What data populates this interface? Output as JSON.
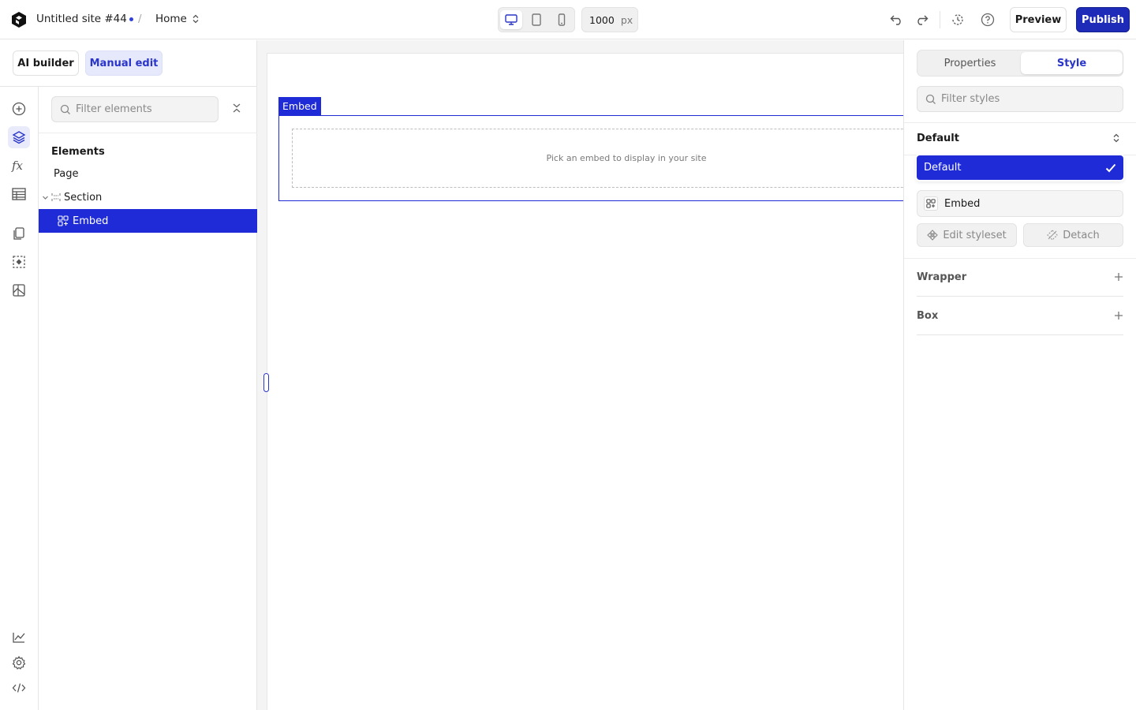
{
  "header": {
    "site_name": "Untitled site #44",
    "separator": "/",
    "page_name": "Home",
    "canvas_width": "1000",
    "canvas_unit": "px",
    "preview_label": "Preview",
    "publish_label": "Publish"
  },
  "modes": {
    "ai_builder": "AI builder",
    "manual_edit": "Manual edit"
  },
  "elements_panel": {
    "filter_placeholder": "Filter elements",
    "heading": "Elements",
    "items": [
      {
        "label": "Page"
      },
      {
        "label": "Section"
      },
      {
        "label": "Embed"
      }
    ]
  },
  "canvas": {
    "selected_tag": "Embed",
    "placeholder_text": "Pick an embed to display in your site"
  },
  "style_panel": {
    "tabs": [
      "Properties",
      "Style"
    ],
    "active_tab": "Style",
    "filter_placeholder": "Filter styles",
    "variant": "Default",
    "variant_option": "Default",
    "styleset_name": "Embed",
    "edit_styleset": "Edit styleset",
    "detach": "Detach",
    "sections": [
      "Wrapper",
      "Box"
    ]
  },
  "colors": {
    "accent": "#1e2bd6",
    "publish": "#1e2bb8",
    "manual_edit_bg": "#e6e8fb"
  }
}
